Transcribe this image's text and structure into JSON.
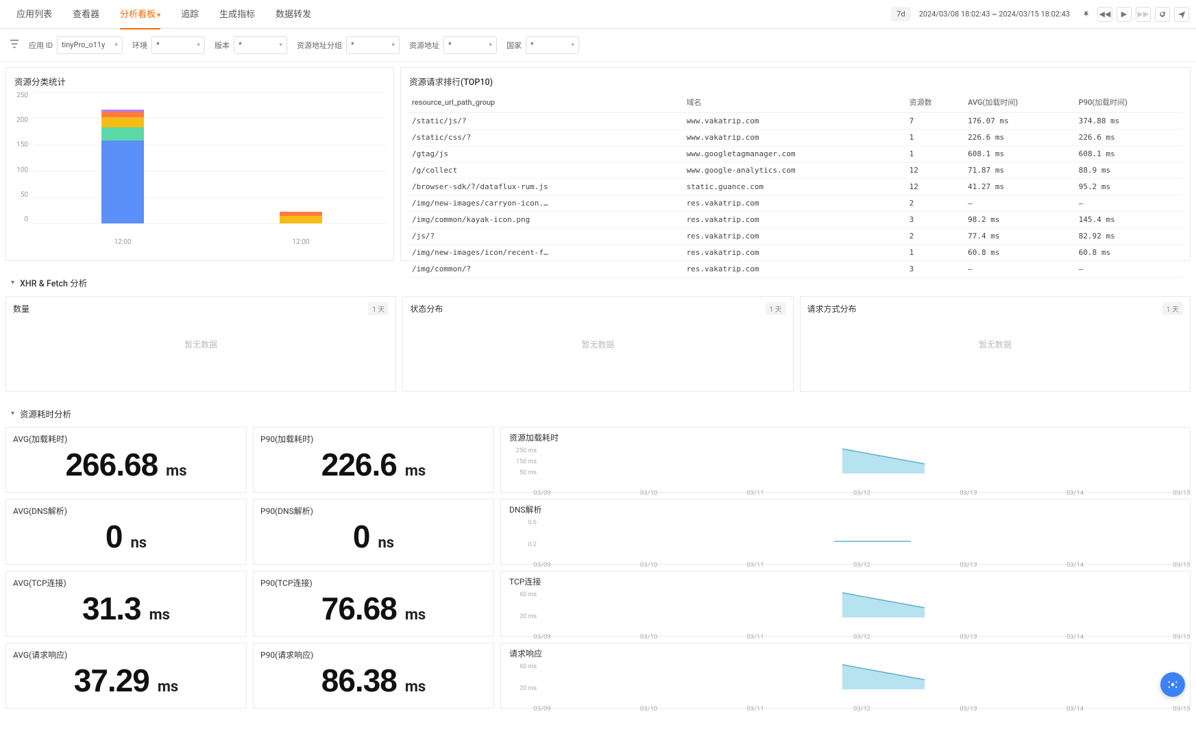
{
  "nav": {
    "tabs": [
      "应用列表",
      "查看器",
      "分析看板",
      "追踪",
      "生成指标",
      "数据转发"
    ],
    "active_index": 2
  },
  "time": {
    "chip": "7d",
    "range": "2024/03/08 18:02:43 ~ 2024/03/15 18:02:43"
  },
  "filters": {
    "app_id_label": "应用 ID",
    "app_id_value": "tinyPro_o11y",
    "env_label": "环境",
    "env_value": "*",
    "version_label": "版本",
    "version_value": "*",
    "url_group_label": "资源地址分组",
    "url_group_value": "*",
    "url_label": "资源地址",
    "url_value": "*",
    "country_label": "国家",
    "country_value": "*"
  },
  "panelA": {
    "title": "资源分类统计",
    "yticks": [
      "250",
      "200",
      "150",
      "100",
      "50",
      "0"
    ],
    "xticks": [
      "12:00",
      "12:00"
    ]
  },
  "chart_data": {
    "type": "bar",
    "stacked": true,
    "ymax": 250,
    "categories": [
      "12:00",
      "12:00"
    ],
    "series": [
      {
        "name": "series1",
        "color": "#5b8ff9",
        "values": [
          158,
          0
        ]
      },
      {
        "name": "series2",
        "color": "#5ad8a6",
        "values": [
          24,
          0
        ]
      },
      {
        "name": "series3",
        "color": "#f6bd16",
        "values": [
          20,
          14
        ]
      },
      {
        "name": "series4",
        "color": "#ff7a45",
        "values": [
          10,
          8
        ]
      },
      {
        "name": "series5",
        "color": "#b37feb",
        "values": [
          4,
          0
        ]
      }
    ]
  },
  "panelB": {
    "title": "资源请求排行(TOP10)",
    "headers": [
      "resource_url_path_group",
      "域名",
      "资源数",
      "AVG(加载时间)",
      "P90(加载时间)"
    ],
    "rows": [
      [
        "/static/js/?",
        "www.vakatrip.com",
        "7",
        "176.07 ms",
        "374.88 ms"
      ],
      [
        "/static/css/?",
        "www.vakatrip.com",
        "1",
        "226.6 ms",
        "226.6 ms"
      ],
      [
        "/gtag/js",
        "www.googletagmanager.com",
        "1",
        "608.1 ms",
        "608.1 ms"
      ],
      [
        "/g/collect",
        "www.google-analytics.com",
        "12",
        "71.87 ms",
        "88.9 ms"
      ],
      [
        "/browser-sdk/?/dataflux-rum.js",
        "static.guance.com",
        "12",
        "41.27 ms",
        "95.2 ms"
      ],
      [
        "/img/new-images/carryon-icon.…",
        "res.vakatrip.com",
        "2",
        "—",
        "—"
      ],
      [
        "/img/common/kayak-icon.png",
        "res.vakatrip.com",
        "3",
        "98.2 ms",
        "145.4 ms"
      ],
      [
        "/js/?",
        "res.vakatrip.com",
        "2",
        "77.4 ms",
        "82.92 ms"
      ],
      [
        "/img/new-images/icon/recent-f…",
        "res.vakatrip.com",
        "1",
        "60.8 ms",
        "60.8 ms"
      ],
      [
        "/img/common/?",
        "res.vakatrip.com",
        "3",
        "—",
        "—"
      ]
    ]
  },
  "sectionXHR": {
    "title": "XHR & Fetch 分析"
  },
  "xhr_panels": [
    {
      "title": "数量",
      "pill": "1 天",
      "empty": "暂无数据"
    },
    {
      "title": "状态分布",
      "pill": "1 天",
      "empty": "暂无数据"
    },
    {
      "title": "请求方式分布",
      "pill": "1 天",
      "empty": "暂无数据"
    }
  ],
  "sectionRes": {
    "title": "资源耗时分析"
  },
  "metrics": [
    {
      "avg_label": "AVG(加载耗时)",
      "avg_val": "266.68",
      "avg_unit": "ms",
      "p90_label": "P90(加载耗时)",
      "p90_val": "226.6",
      "p90_unit": "ms",
      "tl_label": "资源加载耗时",
      "tl_yticks": [
        "250 ms",
        "150 ms",
        "50 ms"
      ],
      "tl_shape": "area"
    },
    {
      "avg_label": "AVG(DNS解析)",
      "avg_val": "0",
      "avg_unit": "ns",
      "p90_label": "P90(DNS解析)",
      "p90_val": "0",
      "p90_unit": "ns",
      "tl_label": "DNS解析",
      "tl_yticks": [
        "0.6",
        "0.2"
      ],
      "tl_shape": "flat"
    },
    {
      "avg_label": "AVG(TCP连接)",
      "avg_val": "31.3",
      "avg_unit": "ms",
      "p90_label": "P90(TCP连接)",
      "p90_val": "76.68",
      "p90_unit": "ms",
      "tl_label": "TCP连接",
      "tl_yticks": [
        "60 ms",
        "20 ms"
      ],
      "tl_shape": "area"
    },
    {
      "avg_label": "AVG(请求响应)",
      "avg_val": "37.29",
      "avg_unit": "ms",
      "p90_label": "P90(请求响应)",
      "p90_val": "86.38",
      "p90_unit": "ms",
      "tl_label": "请求响应",
      "tl_yticks": [
        "60 ms",
        "20 ms"
      ],
      "tl_shape": "area"
    }
  ],
  "tl_xaxis": [
    "03/09",
    "03/10",
    "03/11",
    "03/12",
    "03/13",
    "03/14",
    "03/15"
  ]
}
